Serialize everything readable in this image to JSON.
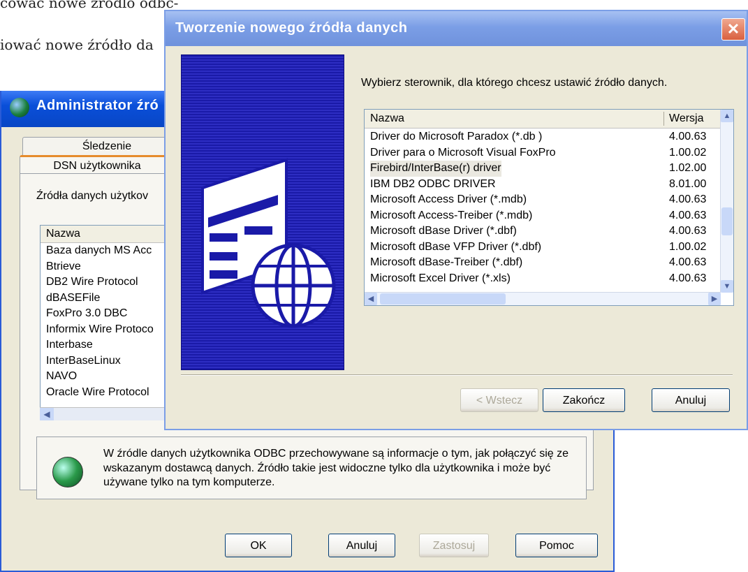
{
  "doc": {
    "line1": "cowac nowe zrodlo odbc-",
    "line2": "iować nowe źródło da"
  },
  "admin": {
    "title": "Administrator źró",
    "tabs": [
      "Śledzenie",
      "DSN użytkownika"
    ],
    "group_label": "Źródła danych użytkov",
    "list_header": "Nazwa",
    "items": [
      "Baza danych MS Acc",
      "Btrieve",
      "DB2 Wire Protocol",
      "dBASEFile",
      "FoxPro 3.0 DBC",
      "Informix Wire Protoco",
      "Interbase",
      "InterBaseLinux",
      "NAVO",
      "Oracle Wire Protocol"
    ],
    "info_text": "W źródle danych użytkownika ODBC przechowywane są informacje o tym, jak połączyć się ze wskazanym dostawcą danych. Źródło takie jest widoczne tylko dla użytkownika i może być używane tylko na tym komputerze.",
    "buttons": {
      "ok": "OK",
      "cancel": "Anuluj",
      "apply": "Zastosuj",
      "help": "Pomoc"
    }
  },
  "wizard": {
    "title": "Tworzenie nowego źródła danych",
    "prompt": "Wybierz sterownik, dla którego chcesz ustawić źródło danych.",
    "columns": {
      "name": "Nazwa",
      "version": "Wersja"
    },
    "drivers": [
      {
        "name": "Driver do Microsoft Paradox (*.db )",
        "version": "4.00.63"
      },
      {
        "name": "Driver para o Microsoft Visual FoxPro",
        "version": "1.00.02"
      },
      {
        "name": "Firebird/InterBase(r) driver",
        "version": "1.02.00",
        "selected": true
      },
      {
        "name": "IBM DB2 ODBC DRIVER",
        "version": "8.01.00"
      },
      {
        "name": "Microsoft Access Driver (*.mdb)",
        "version": "4.00.63"
      },
      {
        "name": "Microsoft Access-Treiber (*.mdb)",
        "version": "4.00.63"
      },
      {
        "name": "Microsoft dBase Driver (*.dbf)",
        "version": "4.00.63"
      },
      {
        "name": "Microsoft dBase VFP Driver (*.dbf)",
        "version": "1.00.02"
      },
      {
        "name": "Microsoft dBase-Treiber (*.dbf)",
        "version": "4.00.63"
      },
      {
        "name": "Microsoft Excel Driver (*.xls)",
        "version": "4.00.63"
      }
    ],
    "buttons": {
      "back": "< Wstecz",
      "finish": "Zakończ",
      "cancel": "Anuluj"
    },
    "close": "✕"
  }
}
